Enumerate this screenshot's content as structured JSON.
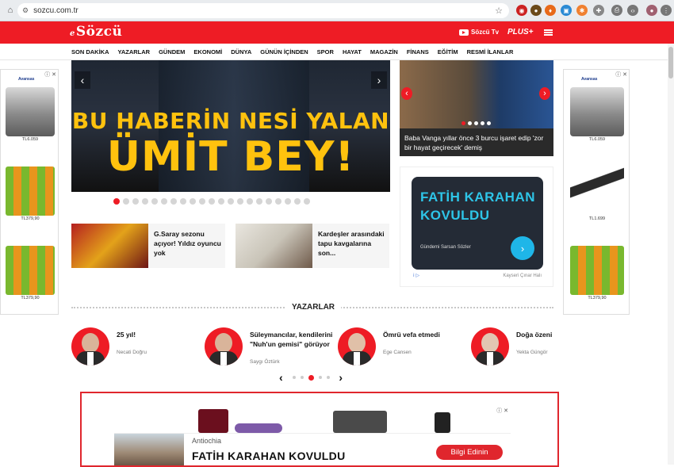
{
  "browser": {
    "url": "sozcu.com.tr"
  },
  "header": {
    "logo": "Sözcü",
    "tv_label": "Sözcü Tv",
    "plus_label": "PLUS+"
  },
  "menu": [
    "SON DAKİKA",
    "YAZARLAR",
    "GÜNDEM",
    "EKONOMİ",
    "DÜNYA",
    "GÜNÜN İÇİNDEN",
    "SPOR",
    "HAYAT",
    "MAGAZİN",
    "FİNANS",
    "EĞİTİM",
    "RESMİ İLANLAR"
  ],
  "left_ad": {
    "brand": "Avansas",
    "products": [
      {
        "price": "TL6.059",
        "kind": "ice-machine"
      },
      {
        "price": "TL379,90",
        "kind": "juice-pack"
      },
      {
        "price": "TL379,90",
        "kind": "juice-pack"
      }
    ]
  },
  "right_ad": {
    "brand": "Avansas",
    "products": [
      {
        "price": "TL6.059",
        "kind": "ice-machine"
      },
      {
        "price": "TL1.699",
        "kind": "pressure-washer"
      },
      {
        "price": "TL379,90",
        "kind": "juice-pack"
      }
    ]
  },
  "hero": {
    "line1": "BU HABERİN NESİ YALAN",
    "line2": "ÜMİT BEY!",
    "slide_count": 21,
    "active_slide": 1
  },
  "cards": [
    {
      "title": "G.Saray sezonu açıyor! Yıldız oyuncu yok"
    },
    {
      "title": "Kardeşler arasındaki tapu kavgalarına son..."
    }
  ],
  "side_story": {
    "caption": "Baba Vanga yıllar önce 3 burcu işaret edip 'zor bir hayat geçirecek' demiş",
    "slide_count": 5,
    "active_slide": 1
  },
  "promo": {
    "title": "FATİH KARAHAN KOVULDU",
    "sub": "Gündemi Sarsan Sözler",
    "source": "Kayseri Çınar Halı"
  },
  "yazarlar": {
    "title": "YAZARLAR",
    "authors": [
      {
        "title": "25 yıl!",
        "name": "Necati Doğru"
      },
      {
        "title": "Süleymancılar, kendilerini \"Nuh'un gemisi\" görüyor",
        "name": "Saygı Öztürk"
      },
      {
        "title": "Ömrü vefa etmedi",
        "name": "Ege Cansen"
      },
      {
        "title": "Doğa özeni",
        "name": "Yekta Güngör"
      }
    ],
    "page_count": 5,
    "active_page": 3
  },
  "bottom_ad": {
    "brand": "Antiochia",
    "headline": "FATİH KARAHAN KOVULDU",
    "cta": "Bilgi Edinin"
  }
}
